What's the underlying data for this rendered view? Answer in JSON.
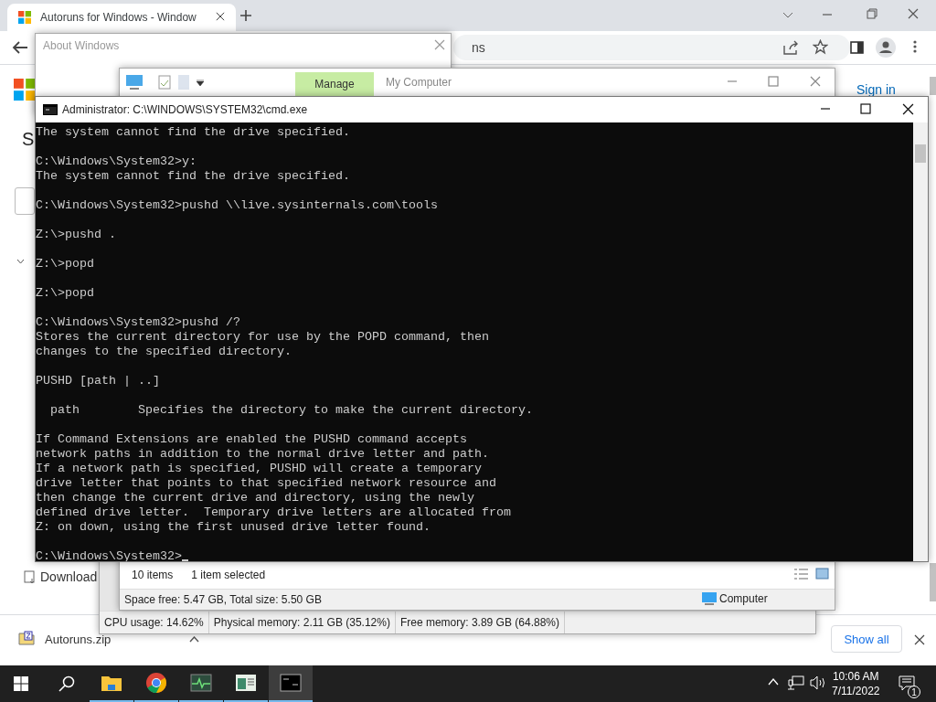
{
  "browser": {
    "tab_title": "Autoruns for Windows - Window",
    "address_fragment": "ns",
    "sign_in": "Sign in",
    "page_heading": "S",
    "download_label": "Download",
    "download_item": "Autoruns.zip",
    "show_all": "Show all"
  },
  "about_window": {
    "title": "About Windows"
  },
  "explorer": {
    "ribbon_tab": "Manage",
    "title": "My Computer",
    "item_count": "10 items",
    "selection": "1 item selected",
    "space": "Space free: 5.47 GB, Total size: 5.50 GB",
    "location": "Computer"
  },
  "monitor_status": [
    "CPU usage: 14.62%",
    "Physical memory: 2.11 GB (35.12%)",
    "Free memory: 3.89 GB (64.88%)"
  ],
  "console": {
    "title": "Administrator: C:\\WINDOWS\\SYSTEM32\\cmd.exe",
    "text": "The system cannot find the drive specified.\n\nC:\\Windows\\System32>y:\nThe system cannot find the drive specified.\n\nC:\\Windows\\System32>pushd \\\\live.sysinternals.com\\tools\n\nZ:\\>pushd .\n\nZ:\\>popd\n\nZ:\\>popd\n\nC:\\Windows\\System32>pushd /?\nStores the current directory for use by the POPD command, then\nchanges to the specified directory.\n\nPUSHD [path | ..]\n\n  path        Specifies the directory to make the current directory.\n\nIf Command Extensions are enabled the PUSHD command accepts\nnetwork paths in addition to the normal drive letter and path.\nIf a network path is specified, PUSHD will create a temporary\ndrive letter that points to that specified network resource and\nthen change the current drive and directory, using the newly\ndefined drive letter.  Temporary drive letters are allocated from\nZ: on down, using the first unused drive letter found.",
    "prompt": "C:\\Windows\\System32>"
  },
  "taskbar": {
    "apps": [
      {
        "kind": "explorer",
        "selected": false
      },
      {
        "kind": "chrome",
        "selected": false
      },
      {
        "kind": "monitor",
        "selected": false
      },
      {
        "kind": "registry",
        "selected": false
      },
      {
        "kind": "console",
        "selected": true
      }
    ],
    "time": "10:06 AM",
    "date": "7/11/2022",
    "notifications": "1"
  }
}
